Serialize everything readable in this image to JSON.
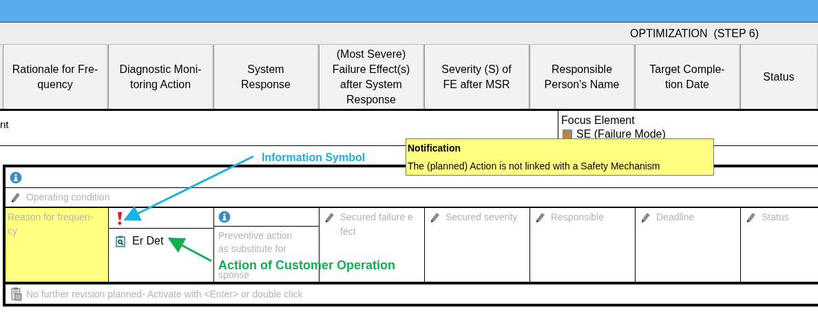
{
  "section": {
    "title": "OPTIMIZATION  (STEP 6)"
  },
  "columns": [
    {
      "lines": [
        "Rationale for Fre-",
        "quency"
      ]
    },
    {
      "lines": [
        "Diagnostic Moni-",
        "toring Action"
      ]
    },
    {
      "lines": [
        "System",
        "Response"
      ]
    },
    {
      "lines": [
        "(Most Severe)",
        "Failure Effect(s)",
        "after System",
        "Response"
      ]
    },
    {
      "lines": [
        "Severity (S) of",
        "FE after MSR"
      ]
    },
    {
      "lines": [
        "Responsible",
        "Person's Name"
      ]
    },
    {
      "lines": [
        "Target Comple-",
        "tion Date"
      ]
    },
    {
      "lines": [
        "Status"
      ]
    }
  ],
  "context": {
    "text": "nt",
    "focus_label": "Focus Element",
    "focus_item": "SE (Failure Mode)"
  },
  "tooltip": {
    "title": "Notification",
    "message": "The (planned) Action is not linked with a Safety Mechanism"
  },
  "table": {
    "condition_placeholder": "Operating condition",
    "rationale_lines": [
      "Reason for frequen-",
      "cy"
    ],
    "action": "Er Det",
    "preventive_lines_top": [
      "Preventive action",
      "as substitute for"
    ],
    "preventive_lines_bottom": [
      "sponse"
    ],
    "cells": [
      {
        "lines": [
          "Secured failure e",
          "fect"
        ]
      },
      {
        "lines": [
          "Secured severity"
        ]
      },
      {
        "lines": [
          "Responsible"
        ]
      },
      {
        "lines": [
          "Deadline"
        ]
      },
      {
        "lines": [
          "Status"
        ]
      }
    ],
    "footer": "No further revision planned- Activate with <Enter> or double click"
  },
  "annotations": [
    {
      "kind": "info",
      "text": "Information Symbol"
    },
    {
      "kind": "action",
      "text": "Action of Customer Operation"
    }
  ]
}
